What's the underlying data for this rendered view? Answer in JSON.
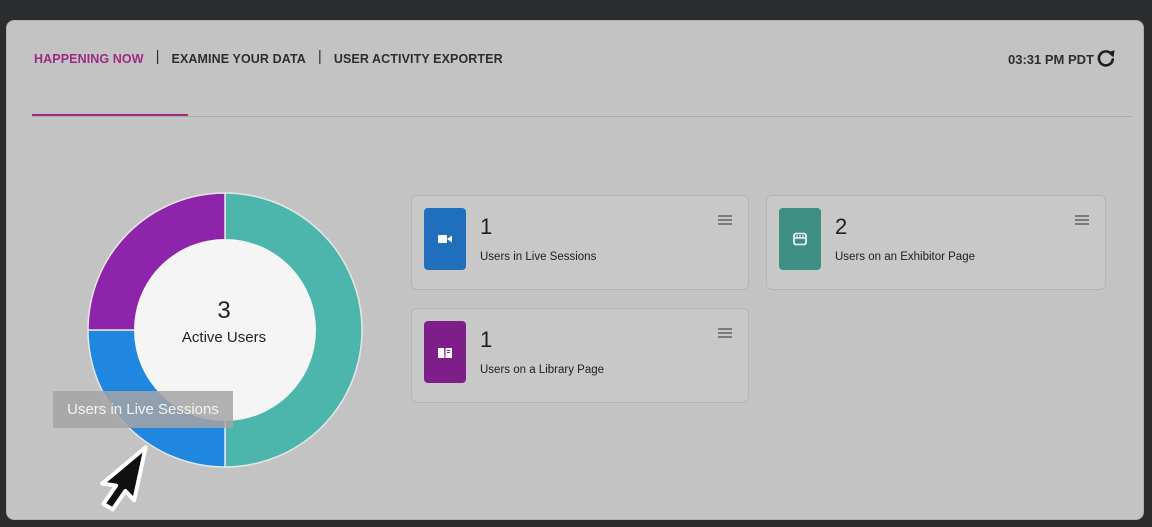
{
  "nav": {
    "tabs": [
      {
        "label": "HAPPENING NOW"
      },
      {
        "label": "EXAMINE YOUR DATA"
      },
      {
        "label": "USER ACTIVITY EXPORTER"
      }
    ],
    "separator": "|"
  },
  "header": {
    "time": "03:31 PM PDT",
    "refresh_icon": "refresh-icon"
  },
  "donut": {
    "count": "3",
    "label": "Active Users",
    "segments": [
      {
        "name": "Users in Live Sessions",
        "value": 1,
        "color": "#1f87e0"
      },
      {
        "name": "Users on an Exhibitor Page",
        "value": 2,
        "color": "#4db6ac"
      },
      {
        "name": "Users on a Library Page",
        "value": 1,
        "color": "#8e24aa"
      }
    ],
    "tooltip": "Users in Live Sessions"
  },
  "cards": [
    {
      "count": "1",
      "label": "Users in Live Sessions",
      "icon": "video-camera-icon",
      "color": "#1f6fbd"
    },
    {
      "count": "2",
      "label": "Users on an Exhibitor Page",
      "icon": "booth-icon",
      "color": "#3d8f84"
    },
    {
      "count": "1",
      "label": "Users on a Library Page",
      "icon": "book-icon",
      "color": "#7e1e88"
    }
  ]
}
